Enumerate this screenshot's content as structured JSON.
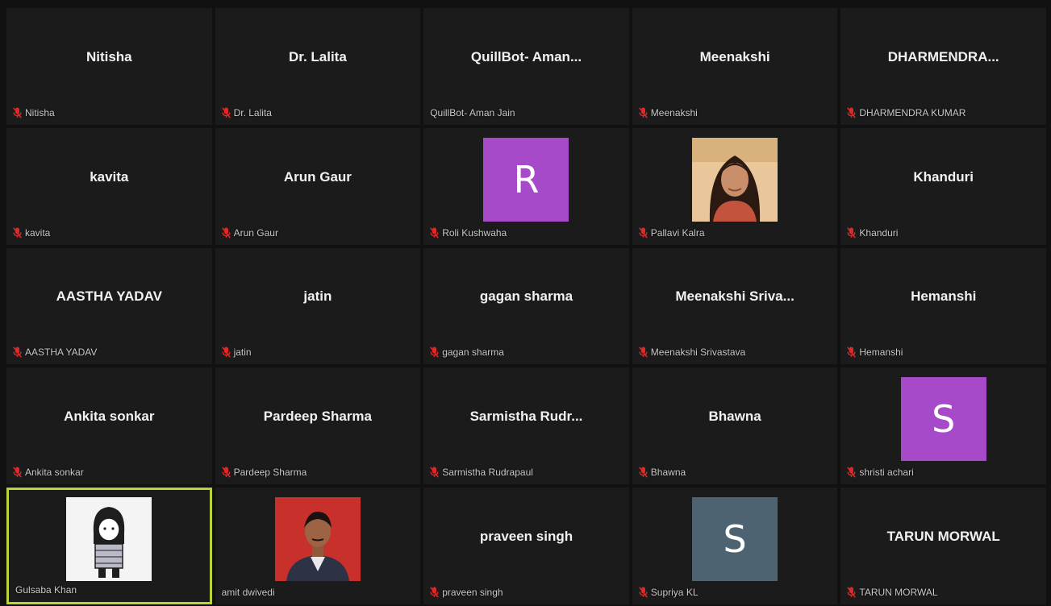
{
  "participants": [
    {
      "display": "Nitisha",
      "label": "Nitisha",
      "muted": true
    },
    {
      "display": "Dr. Lalita",
      "label": "Dr. Lalita",
      "muted": true
    },
    {
      "display": "QuillBot-  Aman...",
      "label": "QuillBot- Aman Jain",
      "muted": false
    },
    {
      "display": "Meenakshi",
      "label": "Meenakshi",
      "muted": true
    },
    {
      "display": "DHARMENDRA...",
      "label": "DHARMENDRA KUMAR",
      "muted": true
    },
    {
      "display": "kavita",
      "label": "kavita",
      "muted": true
    },
    {
      "display": "Arun Gaur",
      "label": "Arun Gaur",
      "muted": true
    },
    {
      "display": "",
      "label": "Roli Kushwaha",
      "muted": true,
      "avatar_letter": "R",
      "avatar_color": "#a64ac9"
    },
    {
      "display": "",
      "label": "Pallavi Kalra",
      "muted": true,
      "photo": "woman"
    },
    {
      "display": "Khanduri",
      "label": "Khanduri",
      "muted": true
    },
    {
      "display": "AASTHA YADAV",
      "label": "AASTHA YADAV",
      "muted": true
    },
    {
      "display": "jatin",
      "label": "jatin",
      "muted": true
    },
    {
      "display": "gagan sharma",
      "label": "gagan sharma",
      "muted": true
    },
    {
      "display": "Meenakshi  Sriva...",
      "label": "Meenakshi Srivastava",
      "muted": true
    },
    {
      "display": "Hemanshi",
      "label": "Hemanshi",
      "muted": true
    },
    {
      "display": "Ankita sonkar",
      "label": "Ankita sonkar",
      "muted": true
    },
    {
      "display": "Pardeep Sharma",
      "label": "Pardeep Sharma",
      "muted": true
    },
    {
      "display": "Sarmistha  Rudr...",
      "label": "Sarmistha Rudrapaul",
      "muted": true
    },
    {
      "display": "Bhawna",
      "label": "Bhawna",
      "muted": true
    },
    {
      "display": "",
      "label": "shristi achari",
      "muted": true,
      "avatar_letter": "S",
      "avatar_color": "#a64ac9"
    },
    {
      "display": "",
      "label": "Gulsaba Khan",
      "muted": false,
      "photo": "cartoon",
      "active": true
    },
    {
      "display": "",
      "label": "amit dwivedi",
      "muted": false,
      "photo": "man"
    },
    {
      "display": "praveen singh",
      "label": "praveen singh",
      "muted": true
    },
    {
      "display": "",
      "label": "Supriya KL",
      "muted": true,
      "avatar_letter": "S",
      "avatar_color": "#4e6371"
    },
    {
      "display": "TARUN MORWAL",
      "label": "TARUN MORWAL",
      "muted": true
    }
  ],
  "colors": {
    "tile_bg": "#1b1b1b",
    "active_border": "#b8d43a",
    "mute_red": "#e02828"
  }
}
